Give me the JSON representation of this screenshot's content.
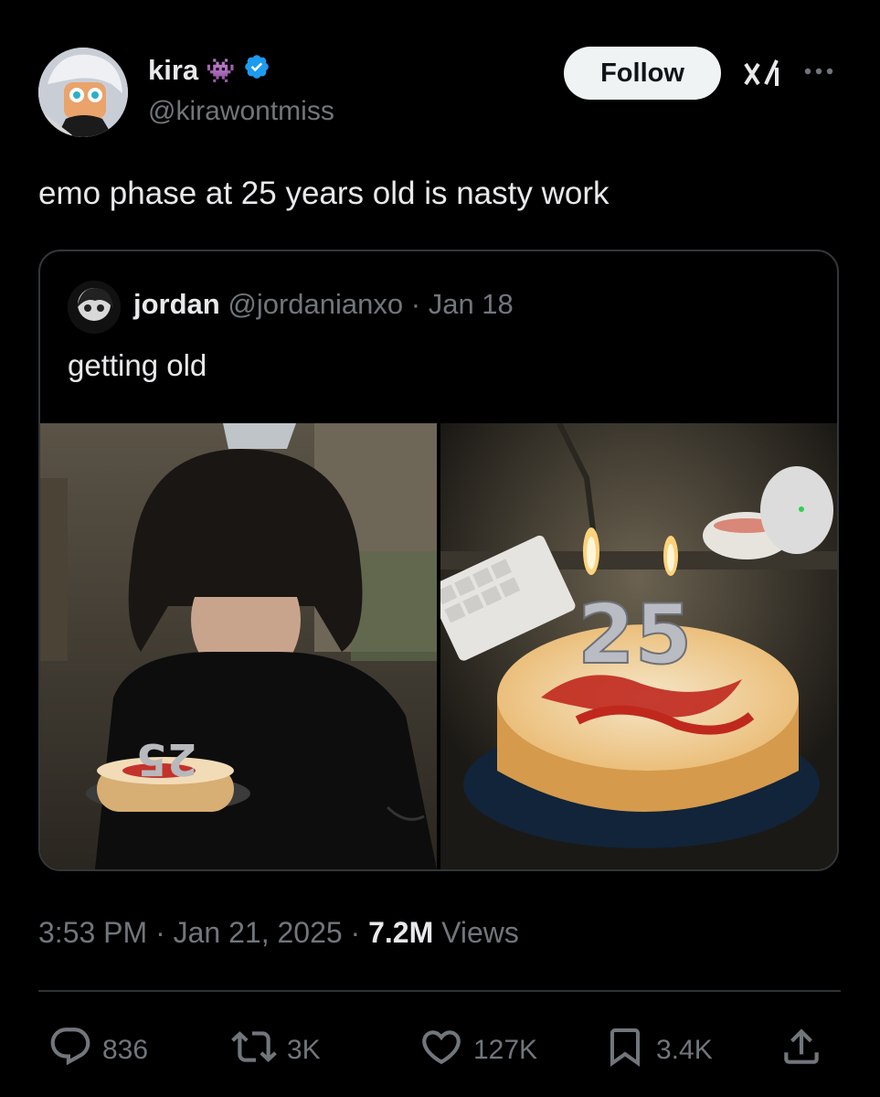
{
  "author": {
    "name": "kira",
    "handle": "@kirawontmiss",
    "emoji": "👾",
    "verified": true
  },
  "follow_label": "Follow",
  "tweet_text": "emo phase at 25 years old is nasty work",
  "quoted": {
    "name": "jordan",
    "handle": "@jordanianxo",
    "separator": "·",
    "date": "Jan 18",
    "text": "getting old"
  },
  "meta": {
    "time": "3:53 PM",
    "sep": "·",
    "date": "Jan 21, 2025",
    "views_count": "7.2M",
    "views_label": "Views"
  },
  "actions": {
    "replies": "836",
    "reposts": "3K",
    "likes": "127K",
    "bookmarks": "3.4K"
  },
  "colors": {
    "background": "#000000",
    "text": "#e7e9ea",
    "muted": "#71767b",
    "verified": "#1d9bf0",
    "border": "#333639"
  },
  "icons": [
    "grok-icon",
    "more-icon",
    "reply-icon",
    "repost-icon",
    "like-icon",
    "bookmark-icon",
    "share-icon",
    "verified-icon"
  ]
}
